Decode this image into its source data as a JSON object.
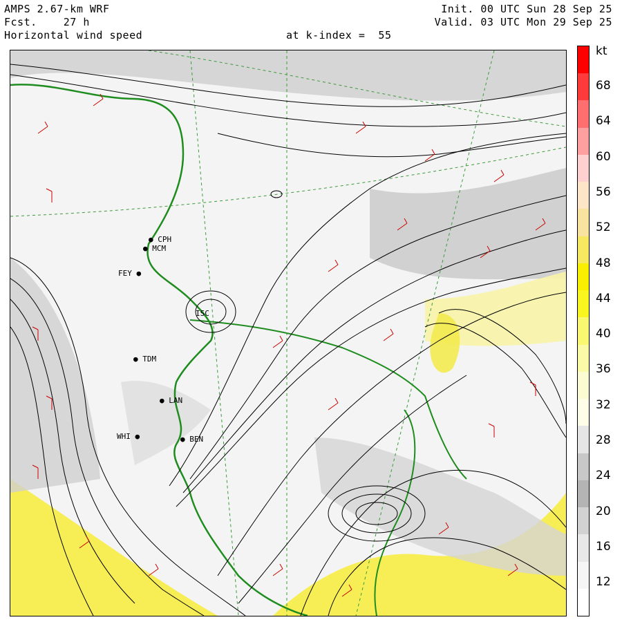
{
  "header": {
    "model": "AMPS 2.67-km WRF",
    "forecast": "Fcst.    27 h",
    "field": "Horizontal wind speed",
    "level": "at k-index =  55",
    "init": "Init. 00 UTC Sun 28 Sep 25",
    "valid": "Valid. 03 UTC Mon 29 Sep 25"
  },
  "colorbar": {
    "unit": "kt",
    "ticks": [
      "68",
      "64",
      "60",
      "56",
      "52",
      "48",
      "44",
      "40",
      "36",
      "32",
      "28",
      "24",
      "20",
      "16",
      "12"
    ],
    "colors": [
      "#ff0000",
      "#ff3a3a",
      "#ff6f6f",
      "#ffa0a0",
      "#ffd0d0",
      "#fde6c8",
      "#f9e3a0",
      "#f6e860",
      "#f8f000",
      "#f9f51e",
      "#faf870",
      "#fbfaa6",
      "#fcfcd2",
      "#fefee8",
      "#e6e6e6",
      "#c8c8c8",
      "#b4b4b4",
      "#d2d2d2",
      "#e8e8e8",
      "#f6f6f6",
      "#ffffff"
    ]
  },
  "stations": [
    {
      "id": "CPH",
      "label": "CPH"
    },
    {
      "id": "MCM",
      "label": "MCM"
    },
    {
      "id": "FEY",
      "label": "FEY"
    },
    {
      "id": "ISC",
      "label": "ISC"
    },
    {
      "id": "TDM",
      "label": "TDM"
    },
    {
      "id": "LAN",
      "label": "LAN"
    },
    {
      "id": "WHI",
      "label": "WHI"
    },
    {
      "id": "BEN",
      "label": "BEN"
    }
  ]
}
